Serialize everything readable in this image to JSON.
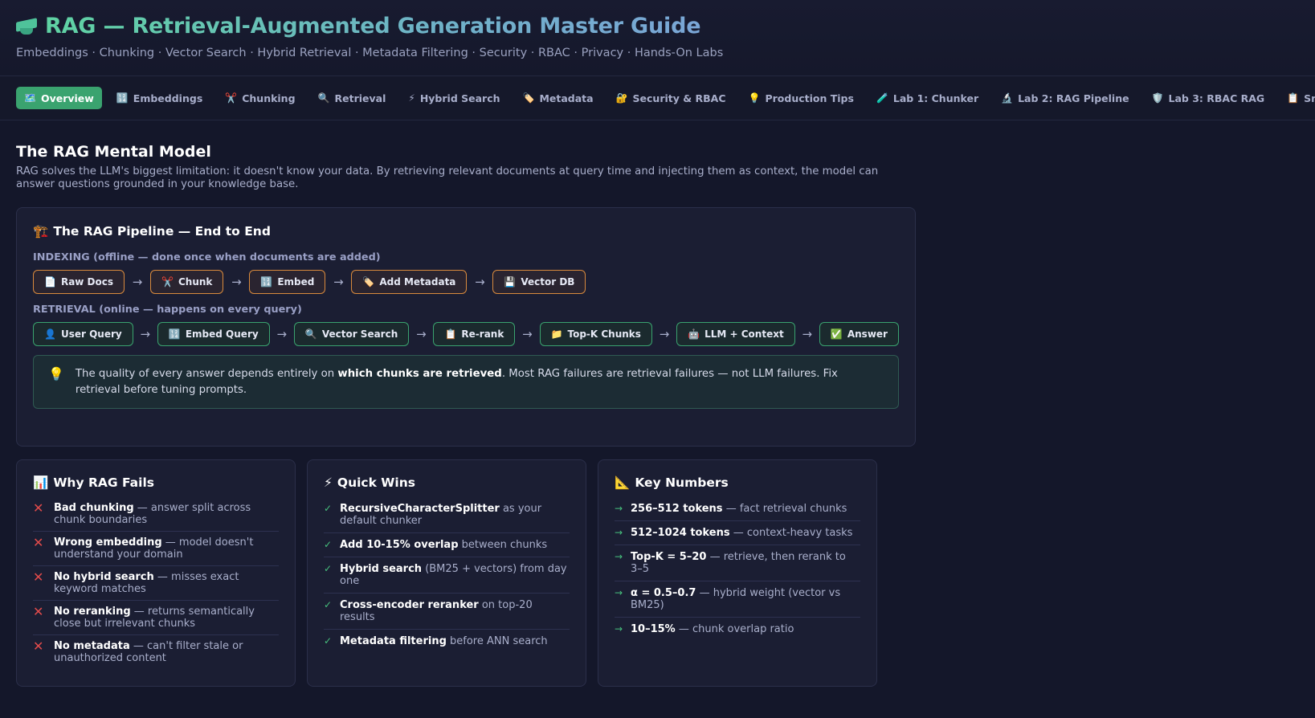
{
  "header": {
    "title": "RAG — Retrieval-Augmented Generation Master Guide",
    "subtitle": "Embeddings · Chunking · Vector Search · Hybrid Retrieval · Metadata Filtering · Security · RBAC · Privacy · Hands-On Labs",
    "logo_icon": "graduation-cap-icon"
  },
  "tabs": [
    {
      "icon": "🗺️",
      "label": "Overview",
      "active": true
    },
    {
      "icon": "🔢",
      "label": "Embeddings"
    },
    {
      "icon": "✂️",
      "label": "Chunking"
    },
    {
      "icon": "🔍",
      "label": "Retrieval"
    },
    {
      "icon": "⚡",
      "label": "Hybrid Search"
    },
    {
      "icon": "🏷️",
      "label": "Metadata"
    },
    {
      "icon": "🔐",
      "label": "Security & RBAC"
    },
    {
      "icon": "💡",
      "label": "Production Tips"
    },
    {
      "icon": "🧪",
      "label": "Lab 1: Chunker"
    },
    {
      "icon": "🔬",
      "label": "Lab 2: RAG Pipeline"
    },
    {
      "icon": "🛡️",
      "label": "Lab 3: RBAC RAG"
    },
    {
      "icon": "📋",
      "label": "Snippets"
    }
  ],
  "main": {
    "title": "The RAG Mental Model",
    "description": "RAG solves the LLM's biggest limitation: it doesn't know your data. By retrieving relevant documents at query time and injecting them as context, the model can answer questions grounded in your knowledge base."
  },
  "pipeline": {
    "icon": "🏗️",
    "title": "The RAG Pipeline — End to End",
    "indexing_label": "INDEXING (offline — done once when documents are added)",
    "indexing_steps": [
      {
        "icon": "📄",
        "label": "Raw Docs"
      },
      {
        "icon": "✂️",
        "label": "Chunk"
      },
      {
        "icon": "🔢",
        "label": "Embed"
      },
      {
        "icon": "🏷️",
        "label": "Add Metadata"
      },
      {
        "icon": "💾",
        "label": "Vector DB"
      }
    ],
    "retrieval_label": "RETRIEVAL (online — happens on every query)",
    "retrieval_steps": [
      {
        "icon": "👤",
        "label": "User Query"
      },
      {
        "icon": "🔢",
        "label": "Embed Query"
      },
      {
        "icon": "🔍",
        "label": "Vector Search"
      },
      {
        "icon": "📋",
        "label": "Re-rank"
      },
      {
        "icon": "📁",
        "label": "Top-K Chunks"
      },
      {
        "icon": "🤖",
        "label": "LLM + Context"
      },
      {
        "icon": "✅",
        "label": "Answer"
      }
    ],
    "arrow": "→",
    "tip": {
      "icon": "💡",
      "before": "The quality of every answer depends entirely on ",
      "bold": "which chunks are retrieved",
      "after": ". Most RAG failures are retrieval failures — not LLM failures. Fix retrieval before tuning prompts."
    }
  },
  "why_fails": {
    "icon": "📊",
    "title": "Why RAG Fails",
    "items": [
      {
        "bold": "Bad chunking",
        "rest": " — answer split across chunk boundaries"
      },
      {
        "bold": "Wrong embedding",
        "rest": " — model doesn't understand your domain"
      },
      {
        "bold": "No hybrid search",
        "rest": " — misses exact keyword matches"
      },
      {
        "bold": "No reranking",
        "rest": " — returns semantically close but irrelevant chunks"
      },
      {
        "bold": "No metadata",
        "rest": " — can't filter stale or unauthorized content"
      }
    ]
  },
  "quick_wins": {
    "icon": "⚡",
    "title": "Quick Wins",
    "items": [
      {
        "bold": "RecursiveCharacterSplitter",
        "rest": " as your default chunker"
      },
      {
        "bold": "Add 10-15% overlap",
        "rest": " between chunks"
      },
      {
        "bold": "Hybrid search",
        "rest": " (BM25 + vectors) from day one"
      },
      {
        "bold": "Cross-encoder reranker",
        "rest": " on top-20 results"
      },
      {
        "bold": "Metadata filtering",
        "rest": " before ANN search"
      }
    ]
  },
  "key_numbers": {
    "icon": "📐",
    "title": "Key Numbers",
    "items": [
      {
        "bold": "256–512 tokens",
        "rest": " — fact retrieval chunks"
      },
      {
        "bold": "512–1024 tokens",
        "rest": " — context-heavy tasks"
      },
      {
        "bold": "Top-K = 5–20",
        "rest": " — retrieve, then rerank to 3–5"
      },
      {
        "bold": "α = 0.5–0.7",
        "rest": " — hybrid weight (vector vs BM25)"
      },
      {
        "bold": "10–15%",
        "rest": " — chunk overlap ratio"
      }
    ]
  },
  "colors": {
    "accent": "#3aa36f",
    "indexing_border": "#d98a3d",
    "retrieval_border": "#3aa36f",
    "fail": "#e24b4b"
  }
}
